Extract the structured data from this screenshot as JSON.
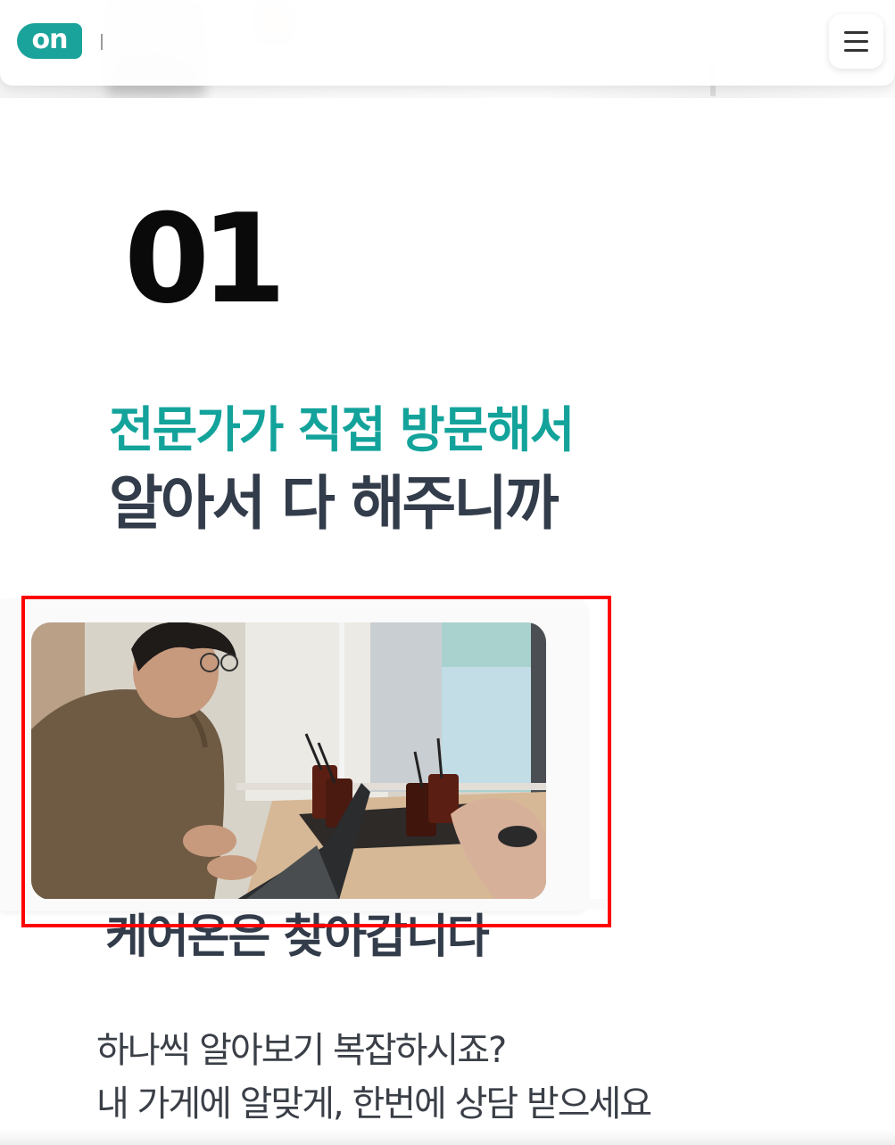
{
  "header": {
    "logo_text": "on",
    "menu_icon": "hamburger-menu-icon",
    "accent_color": "#1aa39a"
  },
  "hero": {
    "step_number": "01",
    "headline_accent": "전문가가 직접 방문해서",
    "headline_main": "알아서 다 해주니까"
  },
  "section": {
    "subheadline": "케어온은 찾아갑니다",
    "body_lines": [
      "하나씩 알아보기 복잡하시죠?",
      "내 가게에 알맞게, 한번에 상담 받으세요"
    ]
  },
  "colors": {
    "accent": "#13a39b",
    "heading": "#333c4a",
    "body": "#3a3f47",
    "highlight": "#ff0000"
  }
}
